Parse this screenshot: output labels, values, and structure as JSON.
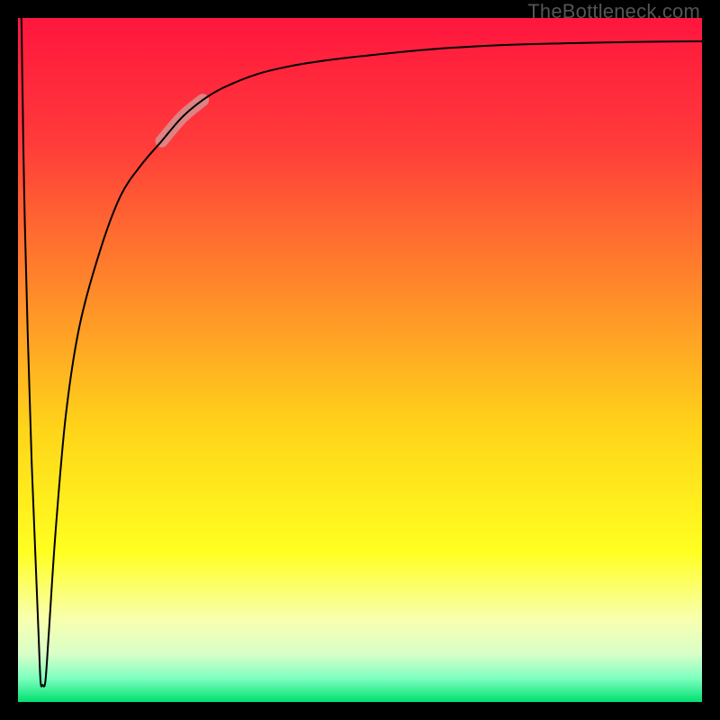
{
  "watermark": "TheBottleneck.com",
  "chart_data": {
    "type": "line",
    "title": "",
    "xlabel": "",
    "ylabel": "",
    "xlim": [
      0,
      100
    ],
    "ylim": [
      0,
      100
    ],
    "grid": false,
    "legend": false,
    "background_gradient": {
      "stops": [
        {
          "pos": 0.0,
          "color": "#ff163e"
        },
        {
          "pos": 0.18,
          "color": "#ff3a3a"
        },
        {
          "pos": 0.4,
          "color": "#ff8a2a"
        },
        {
          "pos": 0.6,
          "color": "#ffd41a"
        },
        {
          "pos": 0.78,
          "color": "#ffff20"
        },
        {
          "pos": 0.88,
          "color": "#f8ffb0"
        },
        {
          "pos": 0.93,
          "color": "#d8ffc8"
        },
        {
          "pos": 0.965,
          "color": "#7fffc0"
        },
        {
          "pos": 1.0,
          "color": "#00e070"
        }
      ]
    },
    "series": [
      {
        "name": "bottleneck-curve",
        "color": "#000000",
        "width": 2,
        "x": [
          0.5,
          1.0,
          2.0,
          3.0,
          3.3,
          3.6,
          4.0,
          4.5,
          5.5,
          7.0,
          9.0,
          12.0,
          15.0,
          18.0,
          21.0,
          24.0,
          27.0,
          30.0,
          35.0,
          40.0,
          45.0,
          50.0,
          60.0,
          70.0,
          80.0,
          90.0,
          100.0
        ],
        "y": [
          100.0,
          70.0,
          35.0,
          10.0,
          3.0,
          2.5,
          3.0,
          10.0,
          25.0,
          42.0,
          55.0,
          66.0,
          74.0,
          78.5,
          82.0,
          85.5,
          88.0,
          89.8,
          91.8,
          93.0,
          93.8,
          94.4,
          95.4,
          96.0,
          96.3,
          96.5,
          96.6
        ]
      }
    ],
    "highlight_segment": {
      "series": "bottleneck-curve",
      "x_start": 21.0,
      "x_end": 27.0,
      "color": "#d89090",
      "width": 14,
      "opacity": 0.85
    }
  }
}
